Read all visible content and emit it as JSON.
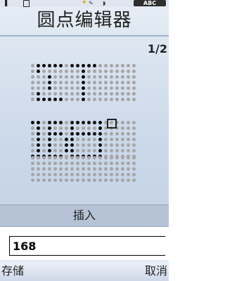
{
  "status_bar": {
    "input_mode": "ABC",
    "icons": [
      "signal-icon",
      "sim-icon",
      "alarm-icon",
      "pen-icon",
      "headset-icon"
    ]
  },
  "title": "圆点编辑器",
  "page_indicator": "1/2",
  "insert_label": "插入",
  "input_value": "168",
  "softkeys": {
    "left": "存储",
    "right": "取消"
  },
  "dot_grids": [
    {
      "rows": 7,
      "cols": 19,
      "on": [
        [
          0,
          1
        ],
        [
          0,
          2
        ],
        [
          0,
          3
        ],
        [
          0,
          4
        ],
        [
          0,
          5
        ],
        [
          0,
          7
        ],
        [
          0,
          8
        ],
        [
          0,
          9
        ],
        [
          0,
          10
        ],
        [
          0,
          11
        ],
        [
          1,
          1
        ],
        [
          1,
          9
        ],
        [
          2,
          3
        ],
        [
          2,
          9
        ],
        [
          3,
          3
        ],
        [
          3,
          9
        ],
        [
          4,
          3
        ],
        [
          4,
          9
        ],
        [
          5,
          1
        ],
        [
          5,
          9
        ],
        [
          6,
          1
        ],
        [
          6,
          2
        ],
        [
          6,
          3
        ],
        [
          6,
          4
        ],
        [
          6,
          5
        ],
        [
          6,
          9
        ]
      ]
    },
    {
      "rows": 7,
      "cols": 19,
      "on": [
        [
          0,
          0
        ],
        [
          0,
          1
        ],
        [
          0,
          3
        ],
        [
          0,
          4
        ],
        [
          0,
          5
        ],
        [
          0,
          7
        ],
        [
          0,
          8
        ],
        [
          0,
          9
        ],
        [
          0,
          10
        ],
        [
          0,
          11
        ],
        [
          0,
          12
        ],
        [
          1,
          1
        ],
        [
          1,
          3
        ],
        [
          1,
          7
        ],
        [
          1,
          12
        ],
        [
          2,
          1
        ],
        [
          2,
          3
        ],
        [
          2,
          4
        ],
        [
          2,
          5
        ],
        [
          2,
          7
        ],
        [
          2,
          8
        ],
        [
          2,
          9
        ],
        [
          2,
          10
        ],
        [
          2,
          11
        ],
        [
          2,
          12
        ],
        [
          3,
          1
        ],
        [
          3,
          3
        ],
        [
          3,
          6
        ],
        [
          3,
          7
        ],
        [
          3,
          12
        ],
        [
          4,
          1
        ],
        [
          4,
          3
        ],
        [
          4,
          6
        ],
        [
          4,
          7
        ],
        [
          4,
          12
        ],
        [
          5,
          1
        ],
        [
          5,
          3
        ],
        [
          5,
          6
        ],
        [
          5,
          7
        ],
        [
          5,
          12
        ],
        [
          6,
          0
        ],
        [
          6,
          1
        ],
        [
          6,
          2
        ],
        [
          6,
          3
        ],
        [
          6,
          4
        ],
        [
          6,
          5
        ],
        [
          6,
          7
        ],
        [
          6,
          8
        ],
        [
          6,
          9
        ],
        [
          6,
          10
        ],
        [
          6,
          11
        ],
        [
          6,
          12
        ]
      ]
    },
    {
      "rows": 5,
      "cols": 19,
      "on": []
    }
  ],
  "colors": {
    "dot_on": "#0a0a0a",
    "dot_off": "#a6a6a6",
    "insert_bar": "#b6c3d6"
  }
}
